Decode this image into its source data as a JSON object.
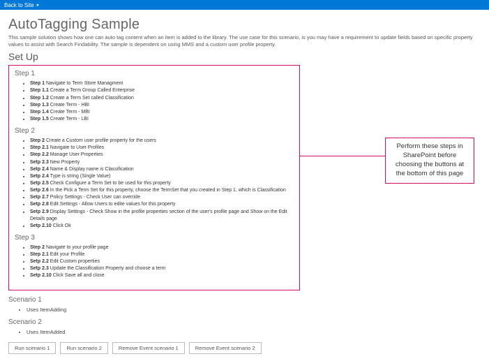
{
  "topbar": {
    "back_label": "Back to Site",
    "caret": "▸"
  },
  "page": {
    "title": "AutoTagging Sample",
    "intro": "This sample solution shows how one can auto tag content when an item is added to the library. The use case for this scenario, is you may have a requirement to update fields based on specific property values to assist with Search Findability. The sample is dependent on using MMS and a custom user profile property.",
    "setup_title": "Set Up"
  },
  "steps": {
    "step1": {
      "heading": "Step 1",
      "items": [
        {
          "b": "Step 1",
          "t": " Navigate to Term Store Managment"
        },
        {
          "b": "Step 1.1",
          "t": " Create a Term Group Called Enterprise"
        },
        {
          "b": "Step 1.2",
          "t": " Create a Term Set called Classification"
        },
        {
          "b": "Step 1.3",
          "t": " Create Term - HBI"
        },
        {
          "b": "Step 1.4",
          "t": " Create Term - MBI"
        },
        {
          "b": "Step 1.5",
          "t": " Create Term - LBI"
        }
      ]
    },
    "step2": {
      "heading": "Step 2",
      "items": [
        {
          "b": "Step 2",
          "t": " Create a Custom user profile property for the users"
        },
        {
          "b": "Step 2.1",
          "t": " Navigate to User Profiles"
        },
        {
          "b": "Step 2.2",
          "t": " Manage User Properties"
        },
        {
          "b": "Setp 2.3",
          "t": " New Property"
        },
        {
          "b": "Setp 2.4",
          "t": " Name & Display name is Classification"
        },
        {
          "b": "Setp 2.4",
          "t": " Type is string (Single Value)"
        },
        {
          "b": "Setp 2.5",
          "t": " Check Configure a Term Set to be used for this property"
        },
        {
          "b": "Setp 2.6",
          "t": " In the Pick a Term Set for this property, choose the TermSet that you created in Step 1, which is Classification"
        },
        {
          "b": "Setp 2.7",
          "t": " Policy Settings - Check User can override"
        },
        {
          "b": "Setp 2.8",
          "t": " Edit Settings - Allow Users to edite values for this property"
        },
        {
          "b": "Setp 2.9",
          "t": " Display Settings - Check Show in the profile properties section of the user's profile page and Show on the Edit Details page"
        },
        {
          "b": "Setp 2.10",
          "t": " Click Ok"
        }
      ]
    },
    "step3": {
      "heading": "Step 3",
      "items": [
        {
          "b": "Step 2",
          "t": " Navigate to your profile page"
        },
        {
          "b": "Step 2.1",
          "t": " Edit your Profile"
        },
        {
          "b": "Setp 2.2",
          "t": " Edit Custom properties"
        },
        {
          "b": "Setp 2.3",
          "t": " Update the Classification Property and choose a term"
        },
        {
          "b": "Setp 2.10",
          "t": " Click Save all and close"
        }
      ]
    }
  },
  "callout": "Perform these steps in SharePoint before choosing the buttons at the bottom of this page",
  "scenarios": {
    "s1": {
      "heading": "Scenario 1",
      "item": "Uses ItemAdding"
    },
    "s2": {
      "heading": "Scenario 2",
      "item": "Uses ItemAdded"
    }
  },
  "buttons": {
    "b1": "Run scenario 1",
    "b2": "Run scenario 2",
    "b3": "Remove Event scenario 1",
    "b4": "Remove Event scenario 2"
  }
}
